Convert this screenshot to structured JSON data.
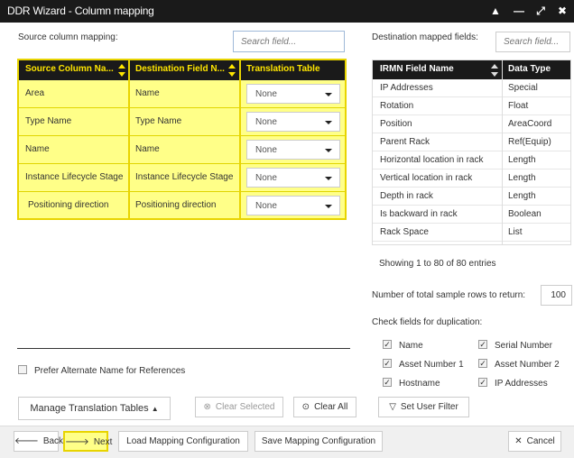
{
  "window": {
    "title": "DDR Wizard - Column mapping",
    "controls": [
      "▲",
      "—",
      "⤢",
      "✖"
    ]
  },
  "left": {
    "label": "Source column mapping:",
    "search_placeholder": "Search field...",
    "columns": [
      "Source Column Na...",
      "Destination Field N...",
      "Translation Table"
    ],
    "rows": [
      {
        "source": "Area",
        "dest": "Name",
        "translation": "None"
      },
      {
        "source": "Type Name",
        "dest": "Type Name",
        "translation": "None"
      },
      {
        "source": "Name",
        "dest": "Name",
        "translation": "None"
      },
      {
        "source": "Instance Lifecycle Stage",
        "dest": "Instance Lifecycle Stage",
        "translation": "None"
      },
      {
        "source": "Positioning direction",
        "dest": "Positioning direction",
        "translation": "None"
      }
    ]
  },
  "right": {
    "label": "Destination mapped fields:",
    "search_placeholder": "Search field...",
    "columns": [
      "IRMN Field Name",
      "Data Type"
    ],
    "rows": [
      {
        "name": "IP Addresses",
        "type": "Special"
      },
      {
        "name": "Rotation",
        "type": "Float"
      },
      {
        "name": "Position",
        "type": "AreaCoord"
      },
      {
        "name": "Parent Rack",
        "type": "Ref(Equip)"
      },
      {
        "name": "Horizontal location in rack",
        "type": "Length"
      },
      {
        "name": "Vertical location in rack",
        "type": "Length"
      },
      {
        "name": "Depth in rack",
        "type": "Length"
      },
      {
        "name": "Is backward in rack",
        "type": "Boolean"
      },
      {
        "name": "Rack Space",
        "type": "List"
      }
    ],
    "entries_info": "Showing 1 to 80 of 80 entries",
    "sample_rows_label": "Number of total sample rows to return:",
    "sample_rows_value": "100",
    "dup_label": "Check fields for duplication:",
    "dup_fields": [
      {
        "label": "Name",
        "checked": true
      },
      {
        "label": "Serial Number",
        "checked": true
      },
      {
        "label": "Asset Number 1",
        "checked": true
      },
      {
        "label": "Asset Number 2",
        "checked": true
      },
      {
        "label": "Hostname",
        "checked": true
      },
      {
        "label": "IP Addresses",
        "checked": true
      }
    ]
  },
  "options": {
    "prefer_alt_label": "Prefer Alternate Name for References",
    "prefer_alt_checked": false
  },
  "actions": {
    "manage_tables": "Manage Translation Tables",
    "clear_selected": "Clear Selected",
    "clear_all": "Clear All",
    "set_user_filter": "Set User Filter"
  },
  "footer": {
    "back": "Back",
    "next": "Next",
    "load": "Load Mapping Configuration",
    "save": "Save Mapping Configuration",
    "cancel": "Cancel"
  }
}
